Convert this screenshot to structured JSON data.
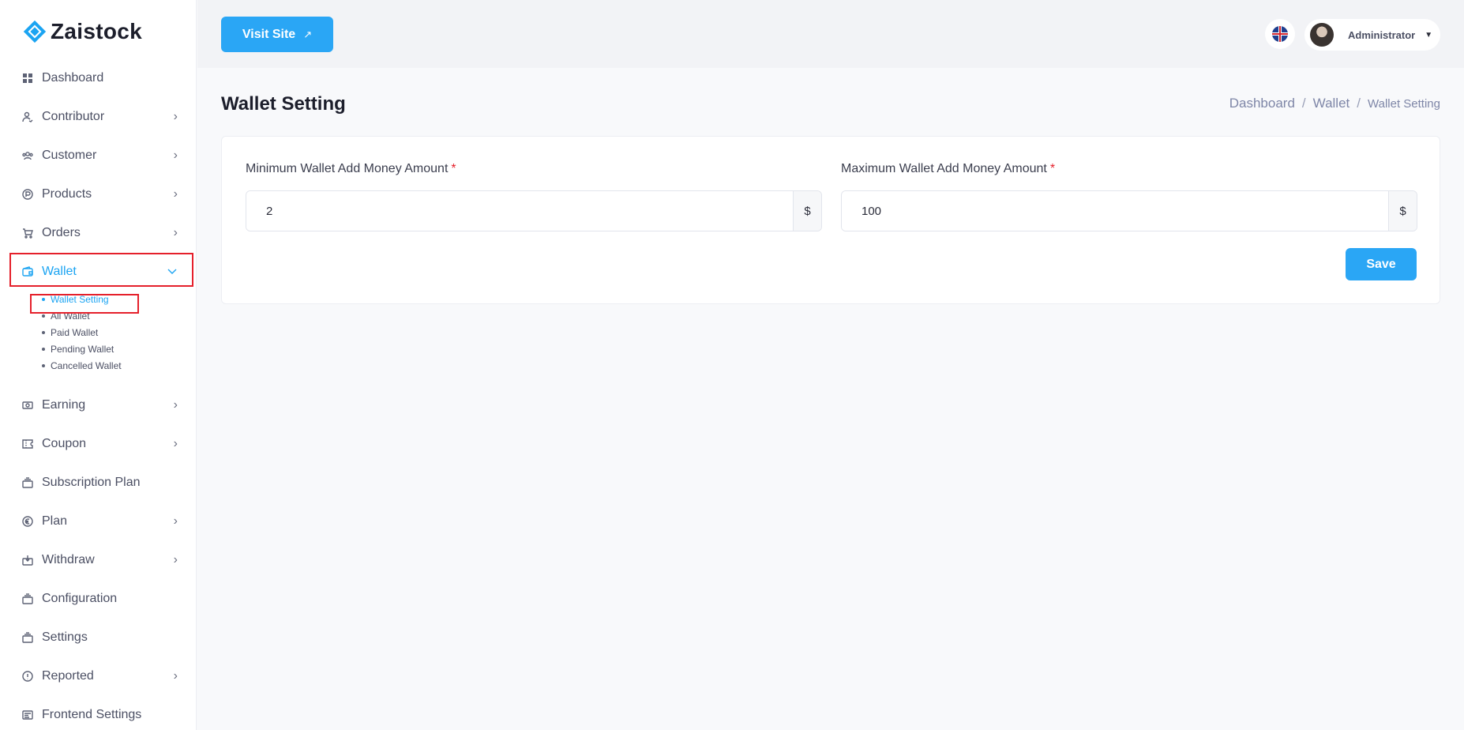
{
  "brand": {
    "name": "Zaistock"
  },
  "sidebar": {
    "items": [
      {
        "label": "Dashboard",
        "icon": "dashboard-icon",
        "chevron": false
      },
      {
        "label": "Contributor",
        "icon": "contributor-icon",
        "chevron": true
      },
      {
        "label": "Customer",
        "icon": "customer-icon",
        "chevron": true
      },
      {
        "label": "Products",
        "icon": "products-icon",
        "chevron": true
      },
      {
        "label": "Orders",
        "icon": "cart-icon",
        "chevron": true
      },
      {
        "label": "Wallet",
        "icon": "wallet-icon",
        "chevron": true,
        "expanded": true,
        "active": true
      },
      {
        "label": "Earning",
        "icon": "earning-icon",
        "chevron": true
      },
      {
        "label": "Coupon",
        "icon": "coupon-icon",
        "chevron": true
      },
      {
        "label": "Subscription Plan",
        "icon": "subscription-icon",
        "chevron": false
      },
      {
        "label": "Plan",
        "icon": "plan-icon",
        "chevron": true
      },
      {
        "label": "Withdraw",
        "icon": "withdraw-icon",
        "chevron": true
      },
      {
        "label": "Configuration",
        "icon": "configuration-icon",
        "chevron": false
      },
      {
        "label": "Settings",
        "icon": "settings-icon",
        "chevron": false
      },
      {
        "label": "Reported",
        "icon": "reported-icon",
        "chevron": true
      },
      {
        "label": "Frontend Settings",
        "icon": "frontend-settings-icon",
        "chevron": false
      }
    ],
    "wallet_submenu": [
      {
        "label": "Wallet Setting",
        "active": true
      },
      {
        "label": "All Wallet"
      },
      {
        "label": "Paid Wallet"
      },
      {
        "label": "Pending Wallet"
      },
      {
        "label": "Cancelled Wallet"
      }
    ]
  },
  "header": {
    "visit_site_label": "Visit Site",
    "user_name": "Administrator"
  },
  "page": {
    "title": "Wallet Setting",
    "breadcrumb": [
      "Dashboard",
      "Wallet",
      "Wallet Setting"
    ]
  },
  "form": {
    "min_label": "Minimum Wallet Add Money Amount",
    "min_value": "2",
    "max_label": "Maximum Wallet Add Money Amount",
    "max_value": "100",
    "required_mark": "*",
    "currency": "$",
    "save_label": "Save"
  },
  "colors": {
    "accent": "#2aa6f5",
    "highlight_border": "#e5202b"
  }
}
